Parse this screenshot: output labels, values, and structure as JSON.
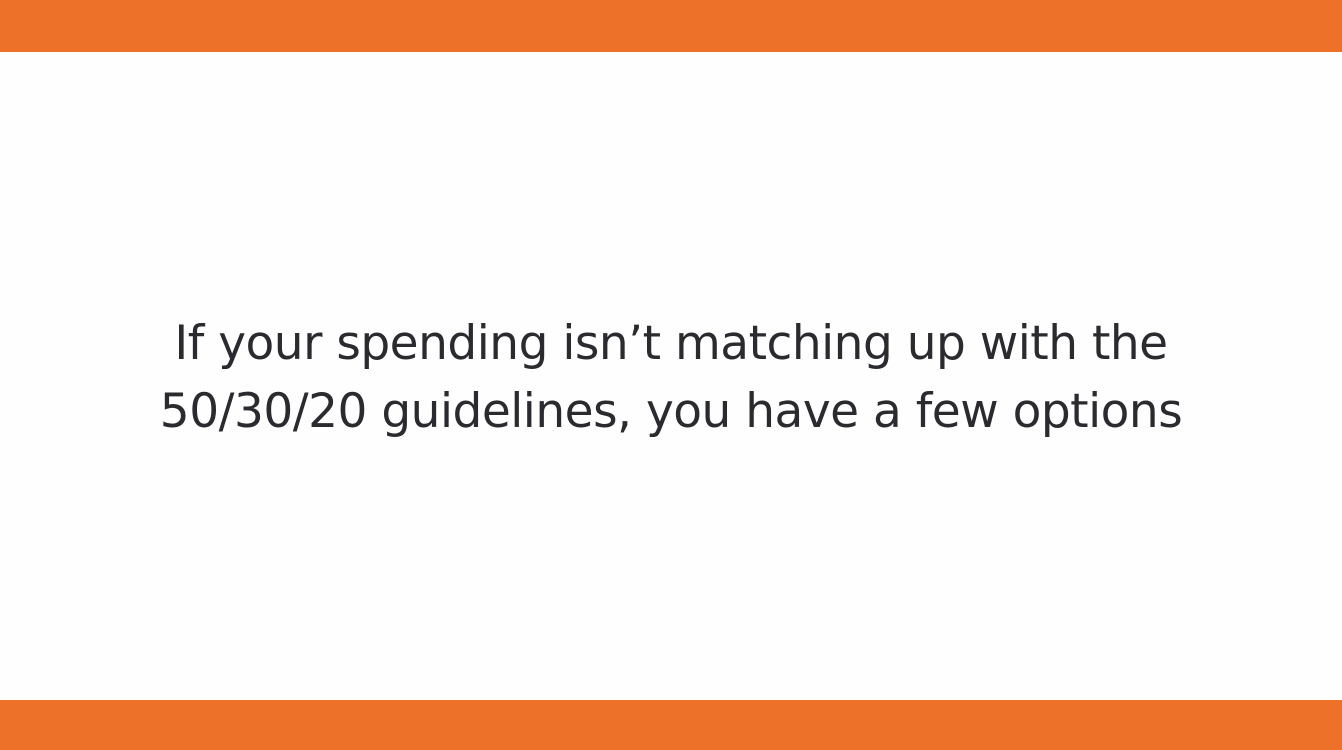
{
  "theme": {
    "accent_color": "#ee712a",
    "background_color": "#fefefe",
    "text_color": "#2b2a2f"
  },
  "slide": {
    "lines": [
      "If your spending isn’t matching up with the",
      "50/30/20 guidelines, you have a few options"
    ]
  }
}
